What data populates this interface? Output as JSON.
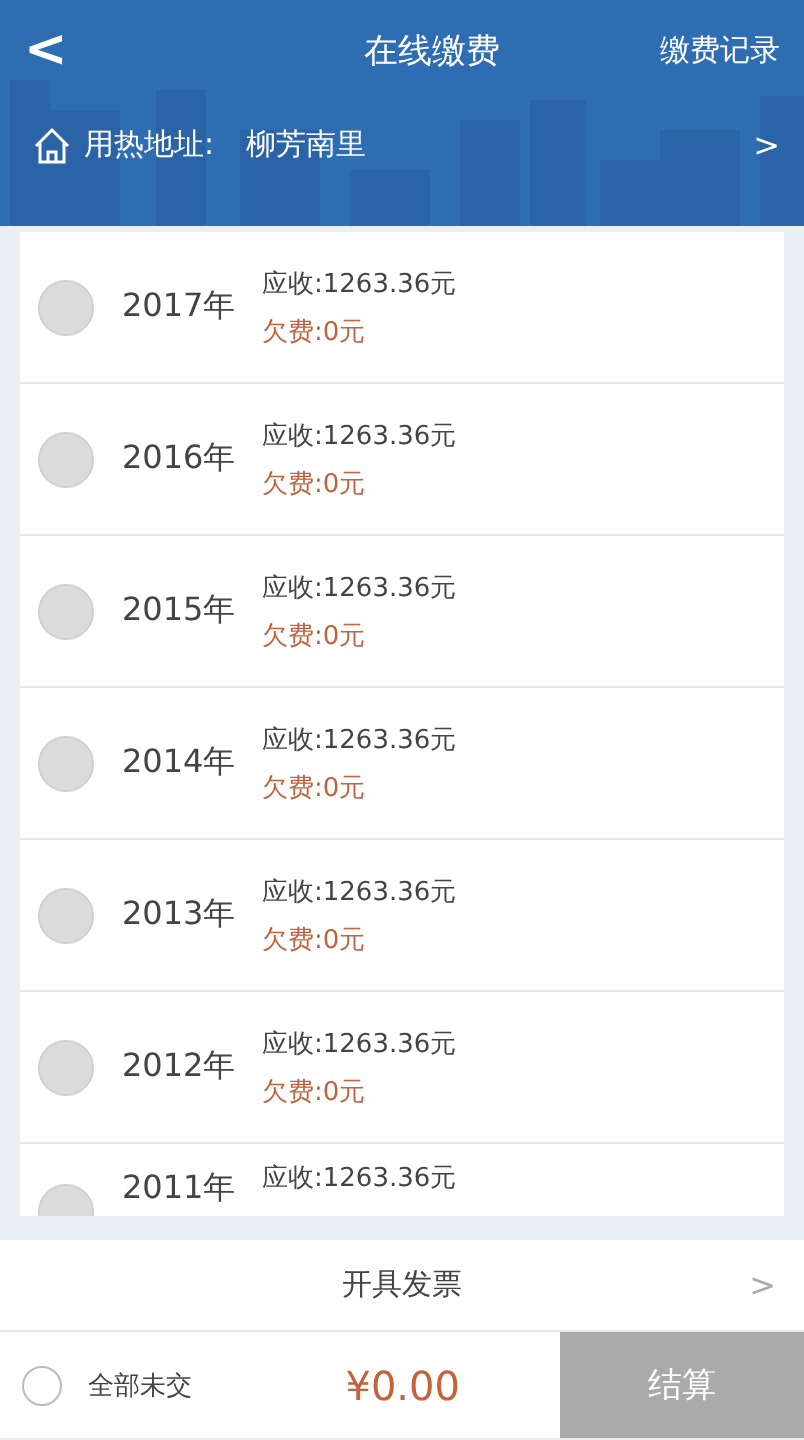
{
  "header": {
    "back": "<",
    "title": "在线缴费",
    "action": "缴费记录"
  },
  "address": {
    "label": "用热地址:",
    "value": "柳芳南里",
    "arrow": ">"
  },
  "bills": [
    {
      "year": "2017年",
      "selected": false,
      "due": "应收:1263.36元",
      "owed": "欠费:0元"
    },
    {
      "year": "2016年",
      "selected": false,
      "due": "应收:1263.36元",
      "owed": "欠费:0元"
    },
    {
      "year": "2015年",
      "selected": false,
      "due": "应收:1263.36元",
      "owed": "欠费:0元"
    },
    {
      "year": "2014年",
      "selected": false,
      "due": "应收:1263.36元",
      "owed": "欠费:0元"
    },
    {
      "year": "2013年",
      "selected": false,
      "due": "应收:1263.36元",
      "owed": "欠费:0元"
    },
    {
      "year": "2012年",
      "selected": false,
      "due": "应收:1263.36元",
      "owed": "欠费:0元"
    },
    {
      "year": "2011年",
      "selected": false,
      "due": "应收:1263.36元"
    }
  ],
  "invoice": {
    "label": "开具发票",
    "arrow": ">"
  },
  "footer": {
    "select_all": {
      "label": "全部未交",
      "selected": false
    },
    "total": "¥0.00",
    "checkout": "结算"
  }
}
